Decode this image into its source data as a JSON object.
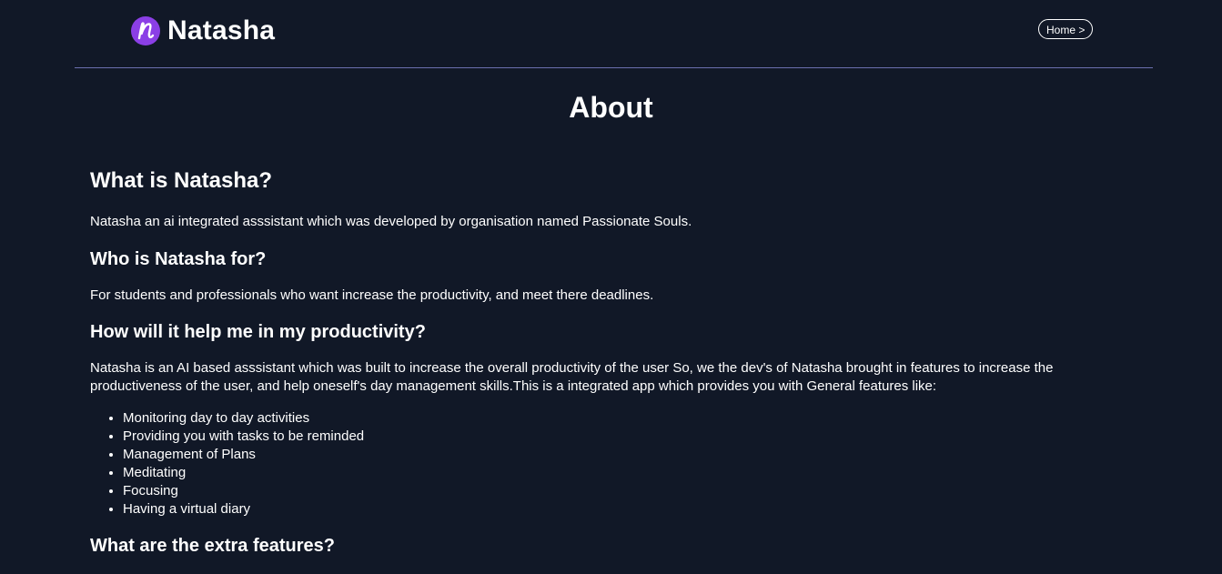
{
  "header": {
    "brand_letter": "n",
    "brand_name": "Natasha",
    "home_label": "Home >"
  },
  "main": {
    "title": "About",
    "sections": [
      {
        "heading": "What is Natasha?",
        "text": "Natasha an ai integrated asssistant which was developed by organisation named Passionate Souls."
      },
      {
        "heading": "Who is Natasha for?",
        "text": "For students and professionals who want increase the productivity, and meet there deadlines."
      },
      {
        "heading": "How will it help me in my productivity?",
        "text": "Natasha is an AI based asssistant which was built to increase the overall productivity of the user So, we the dev's of Natasha brought in features to increase the productiveness of the user, and help oneself's day management skills.This is a integrated app which provides you with General features like:",
        "features": [
          "Monitoring day to day activities",
          "Providing you with tasks to be reminded",
          "Management of Plans",
          "Meditating",
          "Focusing",
          "Having a virtual diary"
        ]
      },
      {
        "heading": "What are the extra features?"
      }
    ]
  },
  "colors": {
    "background": "#111827",
    "brand_accent": "#8b3fe6",
    "divider": "#6b6fae",
    "text": "#ffffff"
  }
}
